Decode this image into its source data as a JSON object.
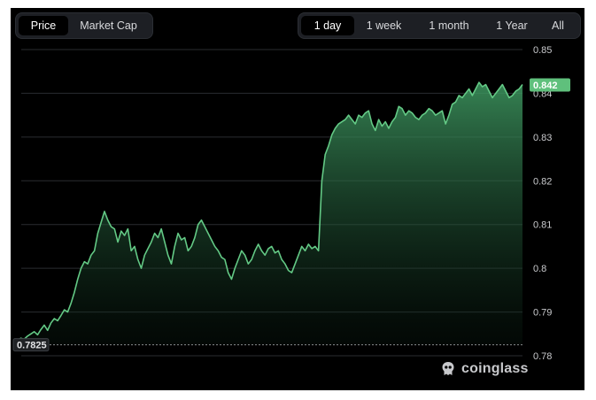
{
  "tabs_left": [
    {
      "label": "Price",
      "active": true
    },
    {
      "label": "Market Cap",
      "active": false
    }
  ],
  "tabs_right": [
    {
      "label": "1 day",
      "active": true
    },
    {
      "label": "1 week",
      "active": false
    },
    {
      "label": "1 month",
      "active": false
    },
    {
      "label": "1 Year",
      "active": false
    },
    {
      "label": "All",
      "active": false
    }
  ],
  "brand": "coinglass",
  "colors": {
    "line": "#63c985",
    "badge_current": "#5fc07c",
    "panel_bg": "#000000"
  },
  "chart_data": {
    "type": "area",
    "ylim": [
      0.78,
      0.85
    ],
    "yticks": [
      "0.85",
      "0.84",
      "0.83",
      "0.82",
      "0.81",
      "0.8",
      "0.79",
      "0.78"
    ],
    "ytick_values": [
      0.85,
      0.84,
      0.83,
      0.82,
      0.81,
      0.8,
      0.79,
      0.78
    ],
    "start_price_label": "0.7825",
    "current_price_label": "0.842",
    "grid": true,
    "series": [
      {
        "values": [
          0.7825,
          0.7835,
          0.784,
          0.7838,
          0.7845,
          0.785,
          0.7855,
          0.7848,
          0.786,
          0.787,
          0.7858,
          0.7875,
          0.7885,
          0.788,
          0.7892,
          0.7905,
          0.79,
          0.792,
          0.7945,
          0.7975,
          0.8,
          0.8015,
          0.801,
          0.803,
          0.804,
          0.808,
          0.8105,
          0.813,
          0.811,
          0.8095,
          0.809,
          0.806,
          0.8085,
          0.8075,
          0.809,
          0.804,
          0.805,
          0.802,
          0.8,
          0.803,
          0.8045,
          0.806,
          0.808,
          0.807,
          0.809,
          0.806,
          0.803,
          0.801,
          0.805,
          0.808,
          0.8065,
          0.807,
          0.804,
          0.805,
          0.807,
          0.81,
          0.811,
          0.8095,
          0.808,
          0.8065,
          0.805,
          0.804,
          0.8025,
          0.802,
          0.799,
          0.7975,
          0.8,
          0.802,
          0.804,
          0.803,
          0.801,
          0.802,
          0.804,
          0.8055,
          0.804,
          0.803,
          0.8045,
          0.805,
          0.8035,
          0.804,
          0.802,
          0.801,
          0.7995,
          0.799,
          0.801,
          0.803,
          0.805,
          0.804,
          0.8055,
          0.8045,
          0.805,
          0.804,
          0.82,
          0.826,
          0.828,
          0.8305,
          0.832,
          0.833,
          0.8335,
          0.834,
          0.835,
          0.834,
          0.833,
          0.835,
          0.8345,
          0.8355,
          0.836,
          0.833,
          0.8315,
          0.834,
          0.8325,
          0.8335,
          0.832,
          0.8335,
          0.8345,
          0.837,
          0.8365,
          0.835,
          0.836,
          0.8355,
          0.8345,
          0.834,
          0.835,
          0.8355,
          0.8365,
          0.836,
          0.835,
          0.8355,
          0.836,
          0.833,
          0.835,
          0.8375,
          0.838,
          0.8395,
          0.839,
          0.84,
          0.841,
          0.8395,
          0.841,
          0.8425,
          0.8415,
          0.842,
          0.8405,
          0.839,
          0.84,
          0.841,
          0.842,
          0.8405,
          0.839,
          0.8395,
          0.8405,
          0.841,
          0.842
        ]
      }
    ]
  }
}
